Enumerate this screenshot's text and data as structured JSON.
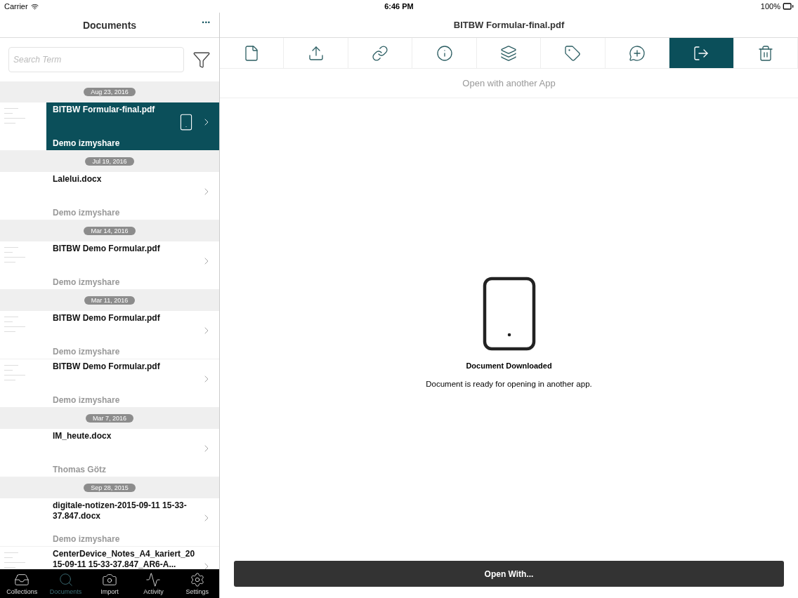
{
  "status_bar": {
    "carrier": "Carrier",
    "time": "6:46 PM",
    "battery": "100%"
  },
  "sidebar": {
    "title": "Documents",
    "more": "•••",
    "search": {
      "placeholder": "Search Term"
    },
    "sections": [
      {
        "date": "Aug 23, 2016",
        "documents": [
          {
            "name": "BITBW Formular-final.pdf",
            "owner": "Demo izmyshare",
            "thumbnail": true,
            "downloaded": true,
            "selected": true
          }
        ]
      },
      {
        "date": "Jul 19, 2016",
        "documents": [
          {
            "name": "Lalelui.docx",
            "owner": "Demo izmyshare",
            "thumbnail": false,
            "downloaded": false,
            "selected": false
          }
        ]
      },
      {
        "date": "Mar 14, 2016",
        "documents": [
          {
            "name": "BITBW Demo Formular.pdf",
            "owner": "Demo izmyshare",
            "thumbnail": true,
            "downloaded": false,
            "selected": false
          }
        ]
      },
      {
        "date": "Mar 11, 2016",
        "documents": [
          {
            "name": "BITBW Demo Formular.pdf",
            "owner": "Demo izmyshare",
            "thumbnail": true,
            "downloaded": false,
            "selected": false
          },
          {
            "name": "BITBW Demo Formular.pdf",
            "owner": "Demo izmyshare",
            "thumbnail": true,
            "downloaded": false,
            "selected": false
          }
        ]
      },
      {
        "date": "Mar 7, 2016",
        "documents": [
          {
            "name": "IM_heute.docx",
            "owner": "Thomas Götz",
            "thumbnail": false,
            "downloaded": false,
            "selected": false
          }
        ]
      },
      {
        "date": "Sep 28, 2015",
        "documents": [
          {
            "name": "digitale-notizen-2015-09-11 15-33-37.847.docx",
            "owner": "Demo izmyshare",
            "thumbnail": false,
            "downloaded": false,
            "selected": false
          },
          {
            "name": "CenterDevice_Notes_A4_kariert_2015-09-11 15-33-37.847_AR6-A...",
            "thumbnail": true,
            "downloaded": false,
            "selected": false
          }
        ]
      }
    ]
  },
  "tab_bar": [
    {
      "label": "Collections",
      "selected": false
    },
    {
      "label": "Documents",
      "selected": true
    },
    {
      "label": "Import",
      "selected": false
    },
    {
      "label": "Activity",
      "selected": false
    },
    {
      "label": "Settings",
      "selected": false
    }
  ],
  "detail": {
    "title": "BITBW Formular-final.pdf",
    "toolbar": [
      {
        "selected": false
      },
      {
        "selected": false
      },
      {
        "selected": false
      },
      {
        "selected": false
      },
      {
        "selected": false
      },
      {
        "selected": false
      },
      {
        "selected": false
      },
      {
        "selected": true
      },
      {
        "selected": false
      }
    ],
    "caption": "Open with another App",
    "message_title": "Document Downloaded",
    "message": "Document is ready for opening in another app.",
    "button": "Open With..."
  }
}
